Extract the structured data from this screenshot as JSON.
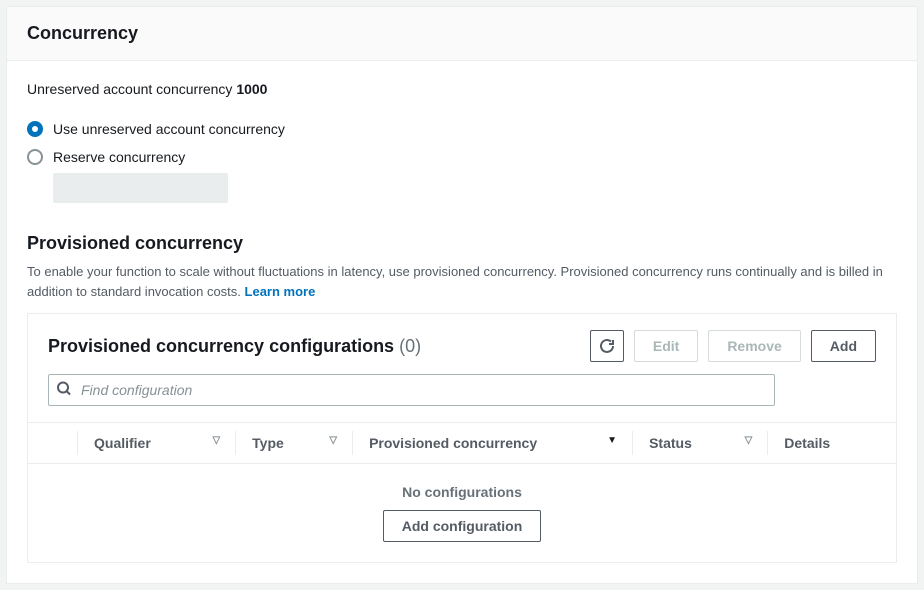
{
  "header": {
    "title": "Concurrency"
  },
  "account": {
    "label": "Unreserved account concurrency ",
    "value": "1000"
  },
  "radios": {
    "unreserved": "Use unreserved account concurrency",
    "reserve": "Reserve concurrency"
  },
  "provisioned": {
    "title": "Provisioned concurrency",
    "description": "To enable your function to scale without fluctuations in latency, use provisioned concurrency. Provisioned concurrency runs continually and is billed in addition to standard invocation costs. ",
    "learn_more": "Learn more"
  },
  "config": {
    "title": "Provisioned concurrency configurations ",
    "count": "(0)",
    "buttons": {
      "refresh": "Refresh",
      "edit": "Edit",
      "remove": "Remove",
      "add": "Add"
    },
    "search_placeholder": "Find configuration",
    "columns": {
      "qualifier": "Qualifier",
      "type": "Type",
      "provisioned": "Provisioned concurrency",
      "status": "Status",
      "details": "Details"
    },
    "empty": {
      "message": "No configurations",
      "button": "Add configuration"
    }
  }
}
